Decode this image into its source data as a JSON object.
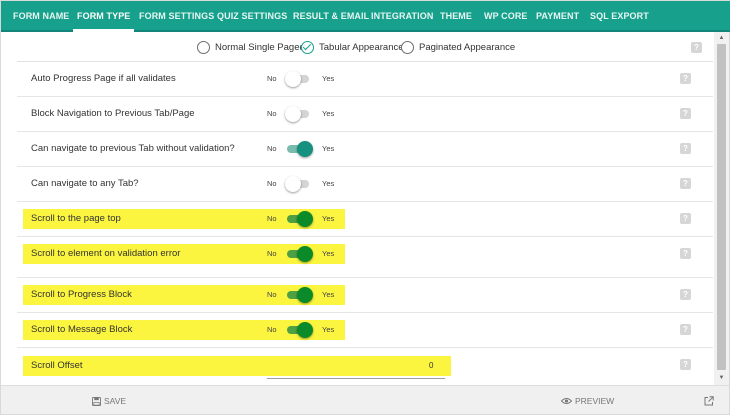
{
  "tabs": [
    {
      "label": "FORM NAME",
      "active": false
    },
    {
      "label": "FORM TYPE",
      "active": true
    },
    {
      "label": "FORM SETTINGS",
      "active": false
    },
    {
      "label": "QUIZ SETTINGS",
      "active": false
    },
    {
      "label": "RESULT & EMAIL",
      "active": false
    },
    {
      "label": "INTEGRATION",
      "active": false
    },
    {
      "label": "THEME",
      "active": false
    },
    {
      "label": "WP CORE",
      "active": false
    },
    {
      "label": "PAYMENT",
      "active": false
    },
    {
      "label": "SQL EXPORT",
      "active": false
    }
  ],
  "appearance": {
    "options": [
      {
        "label": "Normal Single Paged",
        "checked": false
      },
      {
        "label": "Tabular Appearance",
        "checked": true
      },
      {
        "label": "Paginated Appearance",
        "checked": false
      }
    ]
  },
  "settings": [
    {
      "label": "Auto Progress Page if all validates",
      "no": "No",
      "yes": "Yes",
      "value": false,
      "highlighted": false
    },
    {
      "label": "Block Navigation to Previous Tab/Page",
      "no": "No",
      "yes": "Yes",
      "value": false,
      "highlighted": false
    },
    {
      "label": "Can navigate to previous Tab without validation?",
      "no": "No",
      "yes": "Yes",
      "value": true,
      "highlighted": false
    },
    {
      "label": "Can navigate to any Tab?",
      "no": "No",
      "yes": "Yes",
      "value": false,
      "highlighted": false
    },
    {
      "label": "Scroll to the page top",
      "no": "No",
      "yes": "Yes",
      "value": true,
      "highlighted": true
    },
    {
      "label": "Scroll to element on validation error",
      "no": "No",
      "yes": "Yes",
      "value": true,
      "highlighted": true
    },
    {
      "label": "Scroll to Progress Block",
      "no": "No",
      "yes": "Yes",
      "value": true,
      "highlighted": true
    },
    {
      "label": "Scroll to Message Block",
      "no": "No",
      "yes": "Yes",
      "value": true,
      "highlighted": true
    }
  ],
  "scroll_offset": {
    "label": "Scroll Offset",
    "value": "0"
  },
  "help_glyph": "?",
  "footer": {
    "save": "SAVE",
    "preview": "PREVIEW"
  },
  "colors": {
    "accent": "#17a08c",
    "highlight": "#fbf53f",
    "toggle_on": "#0b8a2a"
  }
}
